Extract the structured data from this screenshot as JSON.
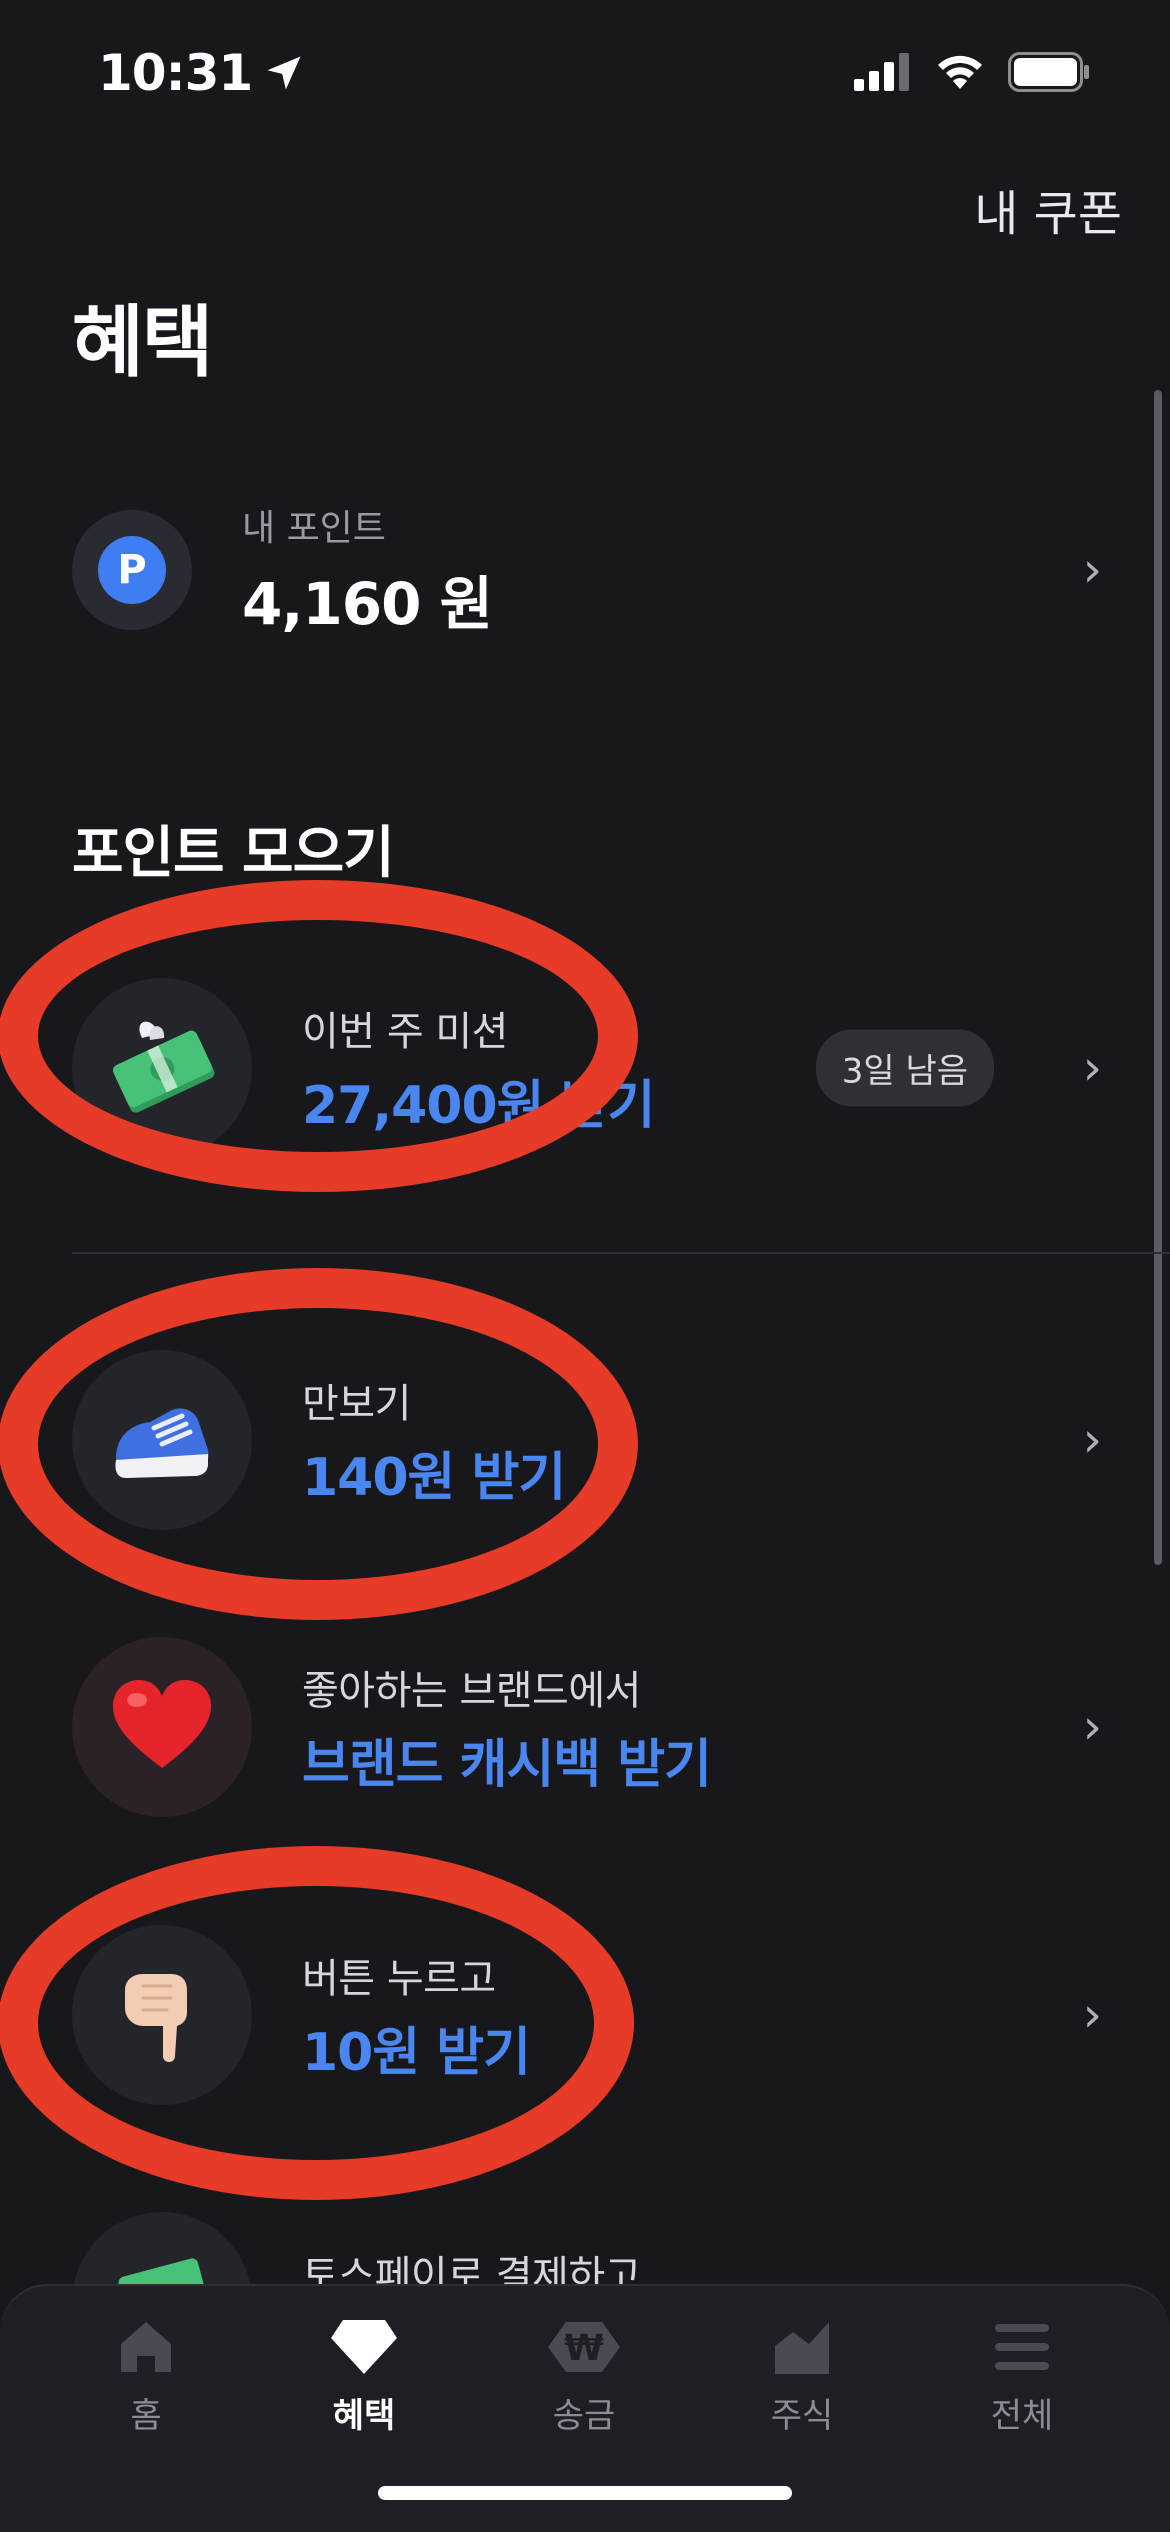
{
  "status_bar": {
    "time": "10:31",
    "battery_level": 1.0
  },
  "header": {
    "coupon_link": "내 쿠폰",
    "title": "혜택"
  },
  "points": {
    "label": "내 포인트",
    "value": "4,160 원",
    "badge": "P"
  },
  "section": {
    "title": "포인트 모으기"
  },
  "items": [
    {
      "sub": "이번 주 미션",
      "main": "27,400원 받기",
      "badge": "3일 남음",
      "icon": "money-wings-icon"
    },
    {
      "sub": "만보기",
      "main": "140원 받기",
      "icon": "sneaker-icon"
    },
    {
      "sub": "좋아하는 브랜드에서",
      "main": "브랜드 캐시백 받기",
      "icon": "heart-icon"
    },
    {
      "sub": "버튼 누르고",
      "main": "10원 받기",
      "icon": "pointing-hand-icon"
    },
    {
      "sub": "토스페이로 결제하고",
      "main": "",
      "icon": "money-icon"
    }
  ],
  "tabs": [
    {
      "label": "홈",
      "icon": "home-icon"
    },
    {
      "label": "혜택",
      "icon": "diamond-icon",
      "active": true
    },
    {
      "label": "송금",
      "icon": "won-icon"
    },
    {
      "label": "주식",
      "icon": "chart-icon"
    },
    {
      "label": "전체",
      "icon": "menu-icon"
    }
  ],
  "colors": {
    "background": "#17171c",
    "accent": "#4a86f0",
    "annotation": "#e63b26"
  }
}
